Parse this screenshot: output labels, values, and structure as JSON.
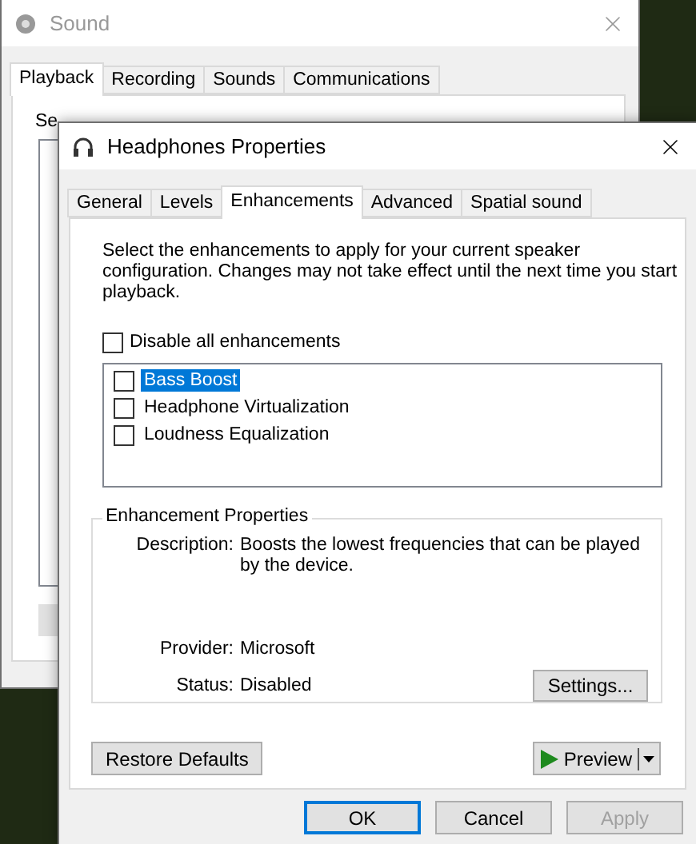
{
  "background_window": {
    "title": "Sound",
    "tabs": [
      {
        "label": "Playback",
        "selected": true
      },
      {
        "label": "Recording",
        "selected": false
      },
      {
        "label": "Sounds",
        "selected": false
      },
      {
        "label": "Communications",
        "selected": false
      }
    ],
    "partial_text": "Se"
  },
  "dialog": {
    "title": "Headphones Properties",
    "tabs": [
      {
        "label": "General",
        "selected": false
      },
      {
        "label": "Levels",
        "selected": false
      },
      {
        "label": "Enhancements",
        "selected": true
      },
      {
        "label": "Advanced",
        "selected": false
      },
      {
        "label": "Spatial sound",
        "selected": false
      }
    ],
    "intro": "Select the enhancements to apply for your current speaker configuration. Changes may not take effect until the next time you start playback.",
    "disable_all": {
      "label": "Disable all enhancements",
      "checked": false
    },
    "enhancements": [
      {
        "label": "Bass Boost",
        "checked": false,
        "selected": true
      },
      {
        "label": "Headphone Virtualization",
        "checked": false,
        "selected": false
      },
      {
        "label": "Loudness Equalization",
        "checked": false,
        "selected": false
      }
    ],
    "properties": {
      "title": "Enhancement Properties",
      "fields": [
        {
          "label": "Description:",
          "value": "Boosts the lowest frequencies that can be played by the device."
        },
        {
          "label": "Provider:",
          "value": "Microsoft"
        },
        {
          "label": "Status:",
          "value": "Disabled"
        }
      ],
      "settings_button": "Settings..."
    },
    "restore_button": "Restore Defaults",
    "preview_button": "Preview",
    "buttons": [
      {
        "label": "OK",
        "default": true,
        "disabled": false
      },
      {
        "label": "Cancel",
        "default": false,
        "disabled": false
      },
      {
        "label": "Apply",
        "default": false,
        "disabled": true
      }
    ]
  }
}
